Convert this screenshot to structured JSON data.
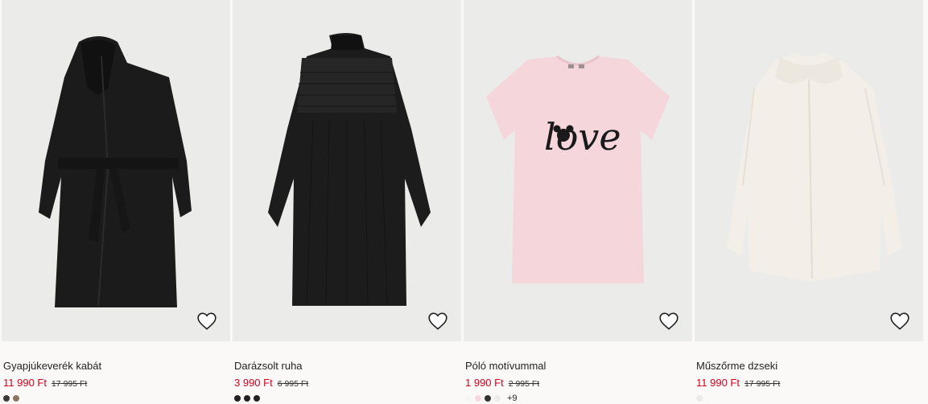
{
  "products": [
    {
      "name": "Gyapjúkeverék kabát",
      "sale_price": "11 990 Ft",
      "original_price": "17 995 Ft",
      "image": "black-wool-blend-coat",
      "swatches": [
        "#3a3a3a",
        "#8a7763"
      ],
      "more": ""
    },
    {
      "name": "Darázsolt ruha",
      "sale_price": "3 990 Ft",
      "original_price": "6 995 Ft",
      "image": "black-smocked-dress",
      "swatches": [
        "#222222",
        "#222222",
        "#222222"
      ],
      "more": ""
    },
    {
      "name": "Póló motívummal",
      "sale_price": "1 990 Ft",
      "original_price": "2 995 Ft",
      "image": "pink-love-tshirt",
      "swatches": [
        "#f6f6f6",
        "#f7d9e2",
        "#333333",
        "#ececec"
      ],
      "more": "+9"
    },
    {
      "name": "Műszőrme dzseki",
      "sale_price": "11 990 Ft",
      "original_price": "17 995 Ft",
      "image": "cream-faux-fur-jacket",
      "swatches": [
        "#eceae6"
      ],
      "more": ""
    }
  ],
  "favorite_icon": "heart-outline-icon",
  "colors": {
    "sale_price": "#d6001c",
    "card_bg": "#ebebea",
    "page_bg": "#faf9f8"
  },
  "tshirt_print": "love"
}
